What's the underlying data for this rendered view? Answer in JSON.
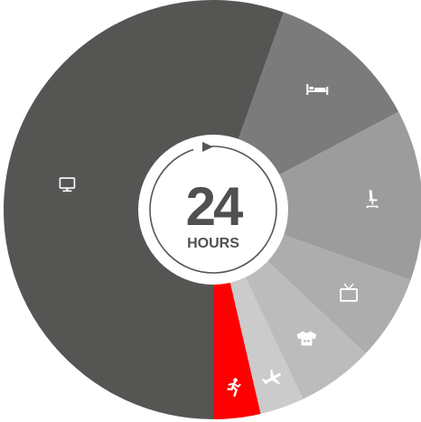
{
  "center": {
    "number": "24",
    "label": "HOURS"
  },
  "chart_data": {
    "type": "pie",
    "title": "",
    "unit": "hours",
    "total": 24,
    "slices": [
      {
        "name": "computer",
        "icon": "monitor-icon",
        "value": 12.2,
        "color": "#555553"
      },
      {
        "name": "sleep",
        "icon": "bed-icon",
        "value": 2.6,
        "color": "#7b7b7b"
      },
      {
        "name": "sitting",
        "icon": "office-chair-icon",
        "value": 2.9,
        "color": "#9c9c9c"
      },
      {
        "name": "tv",
        "icon": "tv-icon",
        "value": 1.45,
        "color": "#adadad"
      },
      {
        "name": "dressing",
        "icon": "shirt-icon",
        "value": 1.3,
        "color": "#bcbcbc"
      },
      {
        "name": "travel",
        "icon": "airplane-icon",
        "value": 0.75,
        "color": "#cbcbcb"
      },
      {
        "name": "exercise",
        "icon": "running-icon",
        "value": 0.8,
        "color": "#ff0000"
      }
    ]
  }
}
